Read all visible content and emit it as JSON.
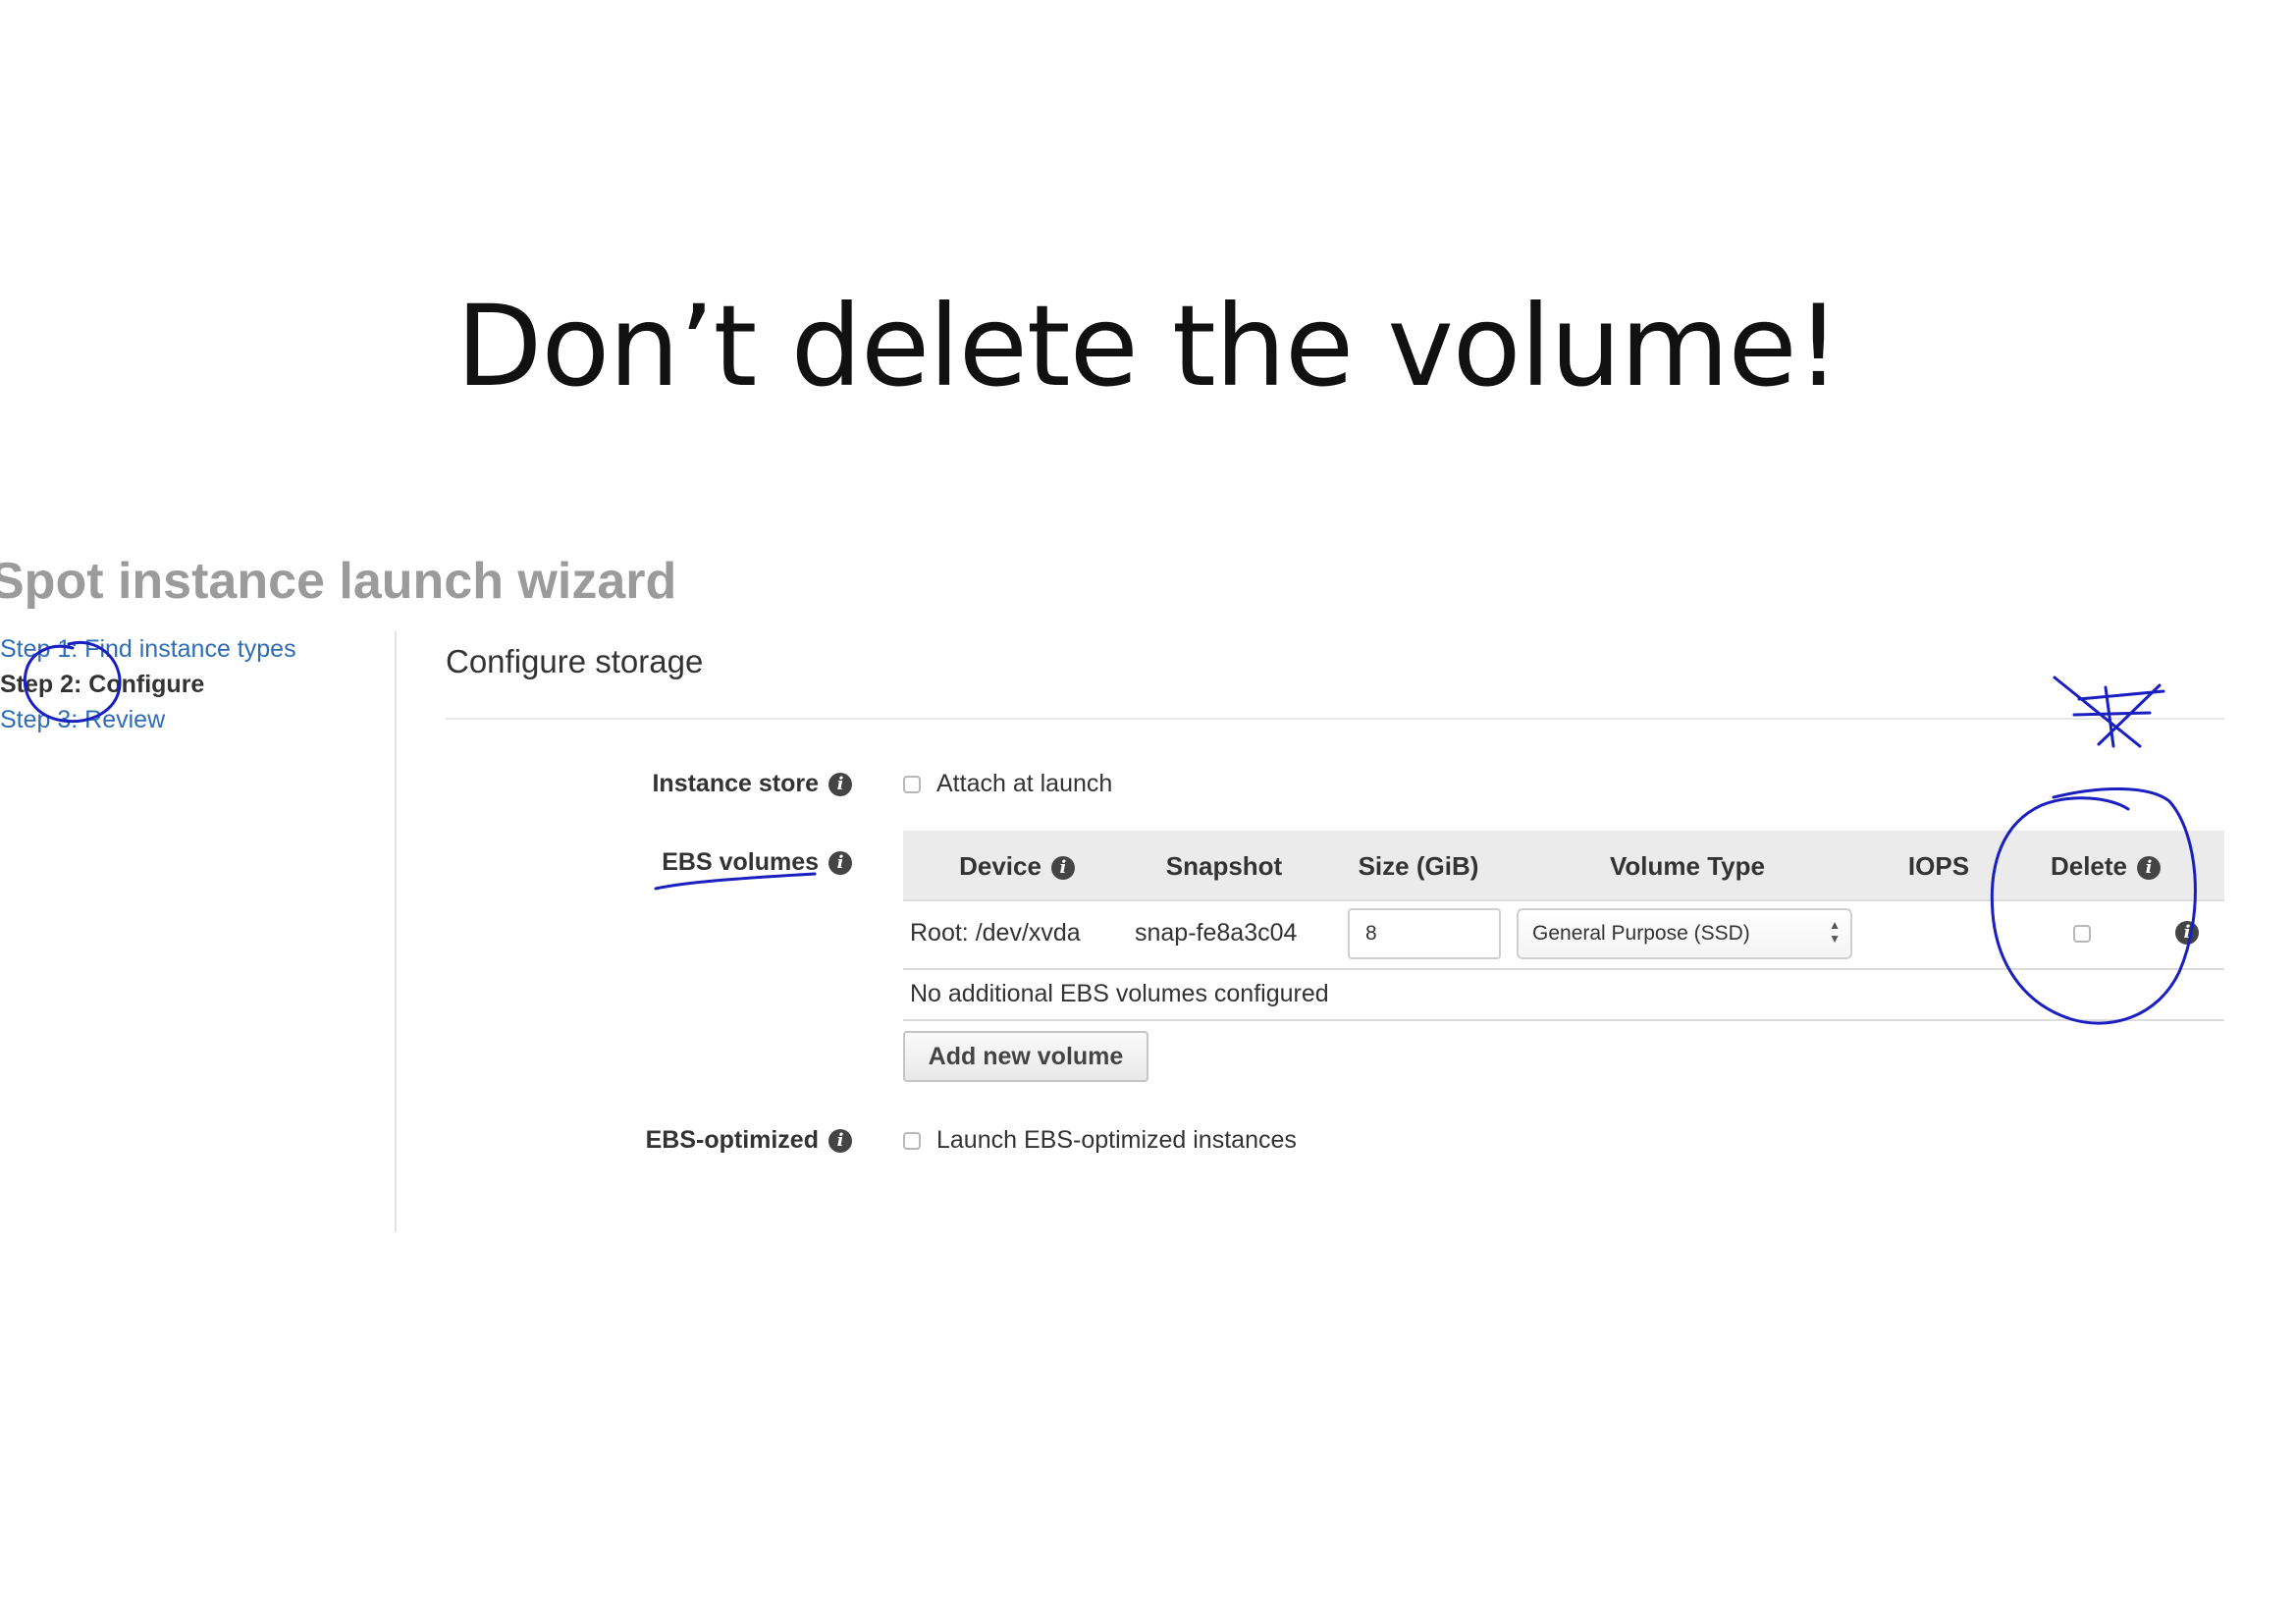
{
  "slide": {
    "title": "Don’t delete the volume!"
  },
  "wizard": {
    "title": "Spot instance launch wizard",
    "steps": [
      {
        "label": "Step 1: Find instance types",
        "state": "link"
      },
      {
        "label": "Step 2: Configure",
        "state": "current"
      },
      {
        "label": "Step 3: Review",
        "state": "link"
      }
    ]
  },
  "storage": {
    "section_title": "Configure storage",
    "instance_store": {
      "label": "Instance store",
      "checkbox_label": "Attach at launch",
      "checked": false
    },
    "ebs_volumes": {
      "label": "EBS volumes",
      "columns": [
        "Device",
        "Snapshot",
        "Size (GiB)",
        "Volume Type",
        "IOPS",
        "Delete"
      ],
      "rows": [
        {
          "device": "Root: /dev/xvda",
          "snapshot": "snap-fe8a3c04",
          "size": "8",
          "volume_type": "General Purpose (SSD)",
          "iops": "",
          "delete": false
        }
      ],
      "empty_message": "No additional EBS volumes configured",
      "add_button": "Add new volume"
    },
    "ebs_optimized": {
      "label": "EBS-optimized",
      "checkbox_label": "Launch EBS-optimized instances",
      "checked": false
    }
  },
  "colors": {
    "link": "#2e6cb5",
    "annotation_ink": "#1a1fc0",
    "header_bg": "#ebebeb",
    "wizard_title": "#9b9b9b"
  }
}
